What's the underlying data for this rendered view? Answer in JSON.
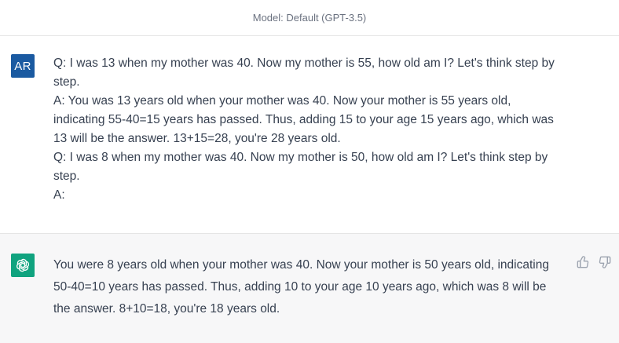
{
  "header": {
    "model_label": "Model: Default (GPT-3.5)"
  },
  "user_message": {
    "avatar_initials": "AR",
    "lines": [
      "Q: I was 13 when my mother was 40. Now my mother is 55, how old am I? Let's think step by step.",
      "A: You was 13 years old when your mother was 40. Now your mother is 55 years old, indicating 55-40=15 years has passed. Thus, adding 15 to your age 15 years ago, which was 13 will be the answer. 13+15=28, you're 28 years old.",
      "Q: I was 8 when my mother was 40. Now my mother is 50, how old am I? Let's think step by step.",
      "A:"
    ]
  },
  "assistant_message": {
    "avatar_icon": "openai-logo-icon",
    "text": "You were 8 years old when your mother was 40. Now your mother is 50 years old, indicating 50-40=10 years has passed. Thus, adding 10 to your age 10 years ago, which was 8 will be the answer. 8+10=18, you're 18 years old.",
    "feedback_icons": [
      "thumbs-up-icon",
      "thumbs-down-icon"
    ]
  },
  "colors": {
    "user_avatar_bg": "#1a5aa1",
    "bot_avatar_bg": "#10a37f",
    "assistant_row_bg": "#f7f7f8"
  }
}
